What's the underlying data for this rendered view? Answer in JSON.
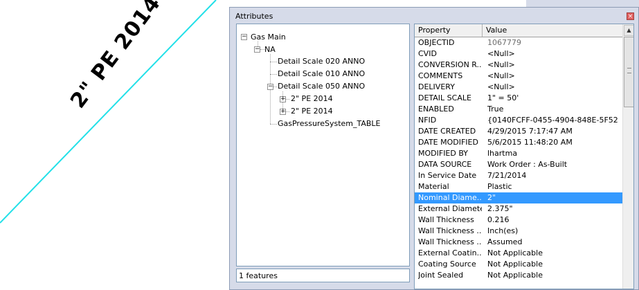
{
  "map": {
    "label": "2\" PE 2014",
    "line_color": "#22e0e8"
  },
  "window": {
    "title": "Attributes",
    "close_glyph": "×"
  },
  "tree": {
    "root": "Gas Main",
    "level1": "NA",
    "items": [
      "Detail Scale 020 ANNO",
      "Detail Scale 010 ANNO",
      "Detail Scale 050 ANNO",
      "2\" PE 2014",
      "2\" PE 2014",
      "GasPressureSystem_TABLE"
    ]
  },
  "status": {
    "text": "1 features"
  },
  "grid": {
    "headers": {
      "property": "Property",
      "value": "Value"
    },
    "selected_color": "#3399ff",
    "rows": [
      {
        "property": "OBJECTID",
        "value": "1067779"
      },
      {
        "property": "CVID",
        "value": "<Null>"
      },
      {
        "property": "CONVERSION R...",
        "value": "<Null>"
      },
      {
        "property": "COMMENTS",
        "value": "<Null>"
      },
      {
        "property": "DELIVERY",
        "value": "<Null>"
      },
      {
        "property": "DETAIL SCALE",
        "value": "1\" = 50'"
      },
      {
        "property": "ENABLED",
        "value": "True"
      },
      {
        "property": "NFID",
        "value": "{0140FCFF-0455-4904-848E-5F52..."
      },
      {
        "property": "DATE CREATED",
        "value": "4/29/2015 7:17:47 AM"
      },
      {
        "property": "DATE MODIFIED",
        "value": "5/6/2015 11:48:20 AM"
      },
      {
        "property": "MODIFIED BY",
        "value": "lhartma"
      },
      {
        "property": "DATA SOURCE",
        "value": "Work Order : As-Built"
      },
      {
        "property": "In Service Date",
        "value": "7/21/2014"
      },
      {
        "property": "Material",
        "value": "Plastic"
      },
      {
        "property": "Nominal Diame...",
        "value": "2\""
      },
      {
        "property": "External Diameter",
        "value": "2.375\""
      },
      {
        "property": "Wall Thickness",
        "value": "0.216"
      },
      {
        "property": "Wall Thickness ...",
        "value": "Inch(es)"
      },
      {
        "property": "Wall Thickness ...",
        "value": "Assumed"
      },
      {
        "property": "External Coatin...",
        "value": "Not Applicable"
      },
      {
        "property": "Coating Source",
        "value": "Not Applicable"
      },
      {
        "property": "Joint Sealed",
        "value": "Not Applicable"
      }
    ]
  }
}
